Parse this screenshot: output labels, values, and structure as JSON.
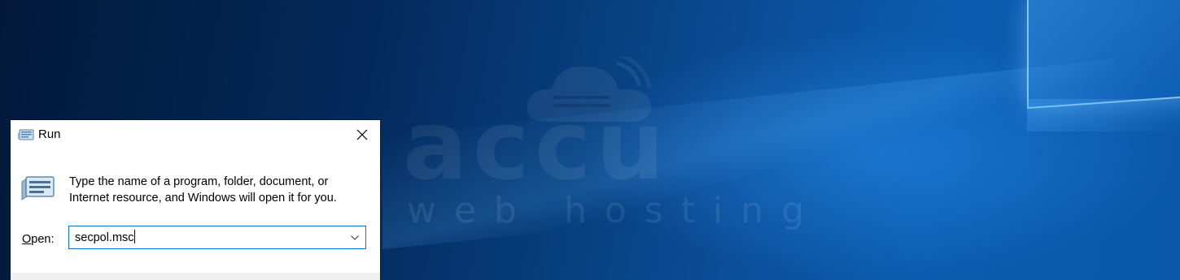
{
  "desktop": {
    "watermark": {
      "word": "accu",
      "subtext": "web hosting"
    }
  },
  "run_dialog": {
    "title": "Run",
    "description": "Type the name of a program, folder, document, or Internet resource, and Windows will open it for you.",
    "open_label_accesskey": "O",
    "open_label_rest": "pen:",
    "open_input_value": "secpol.msc",
    "icons": {
      "title": "run-icon",
      "large": "run-icon",
      "close": "close-icon",
      "dropdown": "chevron-down-icon"
    },
    "colors": {
      "focus_border": "#0078d7",
      "footer": "#f0f0f0"
    }
  }
}
